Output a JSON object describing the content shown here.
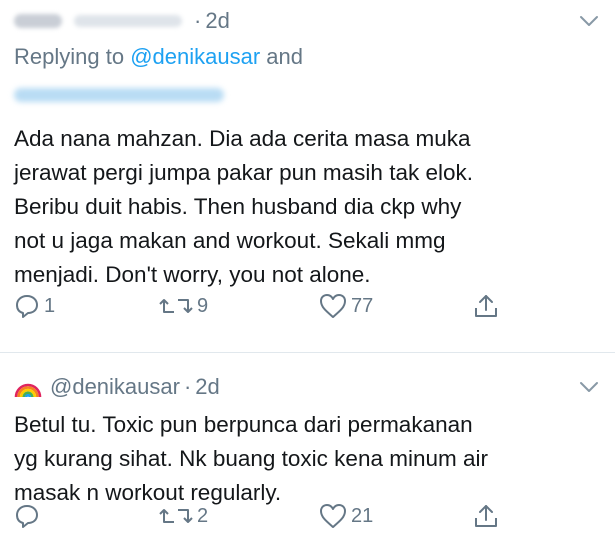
{
  "tweet1": {
    "timestamp": "2d",
    "replying_prefix": "Replying to ",
    "replying_mention": "@denikausar",
    "replying_suffix": " and",
    "lines": [
      "Ada nana mahzan. Dia ada cerita masa muka",
      "jerawat pergi jumpa pakar pun masih tak elok.",
      "Beribu duit habis. Then husband dia ckp why",
      "not u jaga makan and workout. Sekali mmg",
      "menjadi. Don't worry, you not alone."
    ],
    "replies": "1",
    "retweets": "9",
    "likes": "77"
  },
  "tweet2": {
    "handle": "@denikausar",
    "timestamp": "2d",
    "lines": [
      "Betul tu. Toxic pun berpunca dari permakanan",
      "yg kurang sihat. Nk buang toxic kena minum air",
      "masak n workout regularly."
    ],
    "replies": "",
    "retweets": "2",
    "likes": "21"
  },
  "icons": {
    "reply": "reply-icon",
    "retweet": "retweet-icon",
    "like": "heart-icon",
    "share": "share-icon",
    "menu": "chevron-down-icon",
    "emoji": "rainbow-icon"
  },
  "colors": {
    "text": "#14171a",
    "secondary": "#657786",
    "link": "#1da1f2",
    "divider": "#e1e8ed"
  }
}
